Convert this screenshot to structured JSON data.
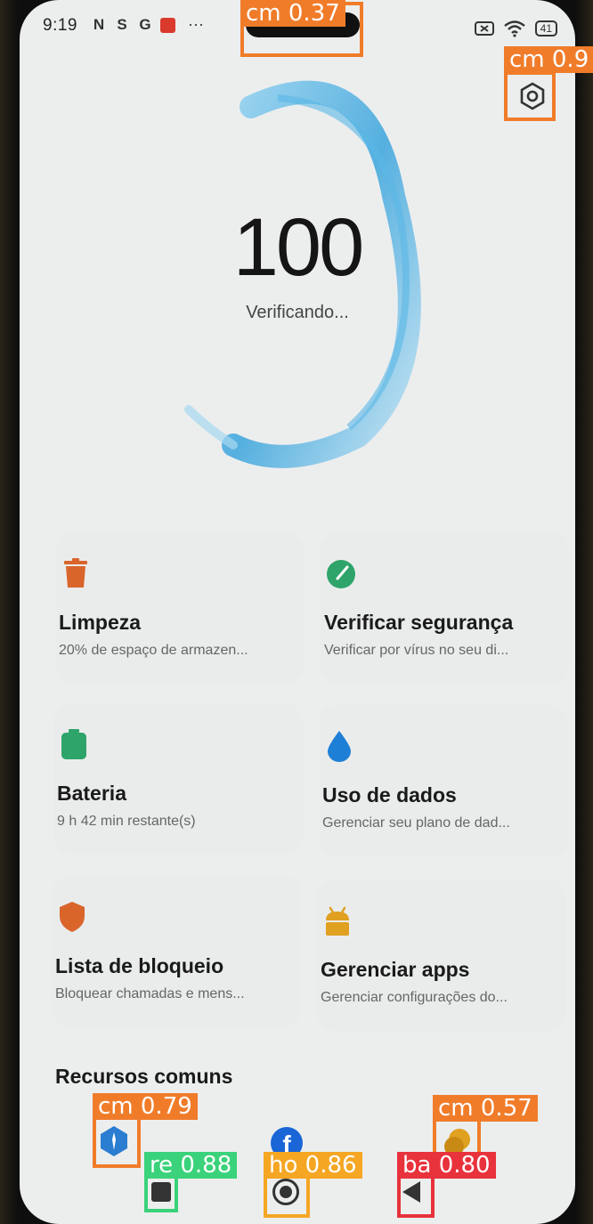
{
  "status_bar": {
    "time": "9:19",
    "icons": [
      "nfc-icon",
      "sim-icon",
      "google-icon",
      "mail-icon"
    ],
    "more": "···",
    "battery": "41"
  },
  "score": {
    "value": "100",
    "status": "Verificando..."
  },
  "cards": [
    {
      "title": "Limpeza",
      "subtitle": "20% de espaço de armazen...",
      "icon": "trash-icon",
      "color": "#d9652b"
    },
    {
      "title": "Verificar segurança",
      "subtitle": "Verificar por vírus no seu di...",
      "icon": "security-check-icon",
      "color": "#2fa46a"
    },
    {
      "title": "Bateria",
      "subtitle": "9 h 42 min  restante(s)",
      "icon": "battery-icon",
      "color": "#2fa46a"
    },
    {
      "title": "Uso de dados",
      "subtitle": "Gerenciar seu plano de dad...",
      "icon": "data-drop-icon",
      "color": "#1e7fd6"
    },
    {
      "title": "Lista de bloqueio",
      "subtitle": "Bloquear chamadas e mens...",
      "icon": "shield-icon",
      "color": "#d9652b"
    },
    {
      "title": "Gerenciar apps",
      "subtitle": "Gerenciar configurações do...",
      "icon": "android-icon",
      "color": "#e0a020"
    }
  ],
  "section": {
    "title": "Recursos comuns"
  },
  "detections": [
    {
      "label": "cm 0.37",
      "color": "#f07c2a"
    },
    {
      "label": "cm 0.9",
      "color": "#f07c2a"
    },
    {
      "label": "cm 0.79",
      "color": "#f07c2a"
    },
    {
      "label": "cm 0.57",
      "color": "#f07c2a"
    },
    {
      "label": "re 0.88",
      "color": "#3ad27a"
    },
    {
      "label": "ho 0.86",
      "color": "#f5a623"
    },
    {
      "label": "ba 0.80",
      "color": "#e8323c"
    }
  ]
}
